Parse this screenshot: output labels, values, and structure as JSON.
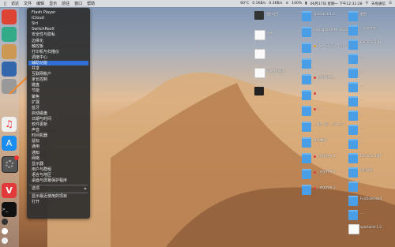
{
  "menubar": {
    "items": [
      "访达",
      "文件",
      "编辑",
      "显示",
      "前往",
      "窗口",
      "帮助"
    ],
    "status": {
      "temp_cpu": "60°C",
      "net_up": "0.1KB/s",
      "net_down": "0.3KB/s",
      "battery": "100%",
      "datetime": "06月17日 星期一 下午12:31:28",
      "user_label": "天地通信"
    }
  },
  "context_menu": {
    "items": [
      {
        "label": "Flash Player"
      },
      {
        "label": "iCloud"
      },
      {
        "label": "Siri"
      },
      {
        "label": "SwitchResX"
      },
      {
        "label": "安全性与隐私"
      },
      {
        "label": "边缘化"
      },
      {
        "label": "触控板"
      },
      {
        "label": "打印机与扫描仪"
      },
      {
        "label": "调度中心"
      },
      {
        "label": "辅助功能",
        "highlight": true
      },
      {
        "label": "共享"
      },
      {
        "label": "互联网帐户"
      },
      {
        "label": "家长控制"
      },
      {
        "label": "键盘"
      },
      {
        "label": "节能"
      },
      {
        "label": "聚焦"
      },
      {
        "label": "扩展"
      },
      {
        "label": "蓝牙"
      },
      {
        "label": "启动磁盘"
      },
      {
        "label": "日期与时间"
      },
      {
        "label": "软件更新"
      },
      {
        "label": "声音"
      },
      {
        "label": "时间机器"
      },
      {
        "label": "鼠标"
      },
      {
        "label": "通用"
      },
      {
        "label": "通知"
      },
      {
        "label": "网络"
      },
      {
        "label": "显示器"
      },
      {
        "label": "用户与群组"
      },
      {
        "label": "语言与地区"
      },
      {
        "label": "桌面与屏幕保护程序"
      }
    ],
    "options_label": "选项",
    "show_recent": "显示最近使用的项目",
    "open_label": "打开"
  },
  "desktop_col1": [
    {
      "label": "图形程序",
      "kind": "app",
      "color": "#333"
    },
    {
      "label": "文稿",
      "kind": "file",
      "color": "#fff"
    },
    {
      "label": "",
      "kind": "file",
      "color": "#fff"
    },
    {
      "label": "屏幕快照.jpg",
      "kind": "file",
      "color": "#fff"
    },
    {
      "label": "",
      "kind": "app",
      "color": "#222"
    }
  ],
  "desktop_col2": [
    {
      "label": "spectacle-1.2",
      "kind": "folder",
      "dot": ""
    },
    {
      "label": "Basingstoke.M...ACOSX-DDG",
      "kind": "folder",
      "dot": ""
    },
    {
      "label": "VS...-v3.22 .macos",
      "kind": "folder",
      "dot": "#e0a030"
    },
    {
      "label": "",
      "kind": "folder",
      "dot": ""
    },
    {
      "label": "...的文件夹...",
      "kind": "folder",
      "dot": "#d84040"
    },
    {
      "label": "",
      "kind": "folder",
      "dot": "#d84040"
    },
    {
      "label": "...",
      "kind": "folder",
      "dot": "#d84040"
    },
    {
      "label": "...Mac OS ...V4.1.0",
      "kind": "folder",
      "dot": ""
    },
    {
      "label": "Mac教程",
      "kind": "folder",
      "dot": ""
    },
    {
      "label": "...的文件夹 1",
      "kind": "folder",
      "dot": "#d84040"
    },
    {
      "label": "...的文件夹 2",
      "kind": "folder",
      "dot": "#d84040"
    },
    {
      "label": "...的文件夹 3",
      "kind": "folder",
      "dot": "#d84040"
    }
  ],
  "desktop_col3": [
    {
      "label": "截图",
      "kind": "folder"
    },
    {
      "label": "...的文件夹",
      "kind": "folder"
    },
    {
      "label": "RECYCLE BIN",
      "kind": "folder"
    },
    {
      "label": "...",
      "kind": "folder"
    },
    {
      "label": "...",
      "kind": "folder"
    },
    {
      "label": "...",
      "kind": "folder"
    },
    {
      "label": "...",
      "kind": "folder"
    },
    {
      "label": "...",
      "kind": "folder"
    },
    {
      "label": "...",
      "kind": "folder"
    },
    {
      "label": "...",
      "kind": "folder"
    },
    {
      "label": "RECYCLE BIN",
      "kind": "folder"
    },
    {
      "label": "项目文件",
      "kind": "folder"
    },
    {
      "label": "...",
      "kind": "folder"
    },
    {
      "label": "FonDownload",
      "kind": "folder"
    },
    {
      "label": "...",
      "kind": "folder"
    },
    {
      "label": "spectacle-1.2",
      "kind": "file"
    }
  ],
  "colors": {
    "menu_bg": "#2e2e2e",
    "highlight": "#2f6fd6",
    "folder": "#4a9ee6",
    "arrow": "#f08a30"
  }
}
